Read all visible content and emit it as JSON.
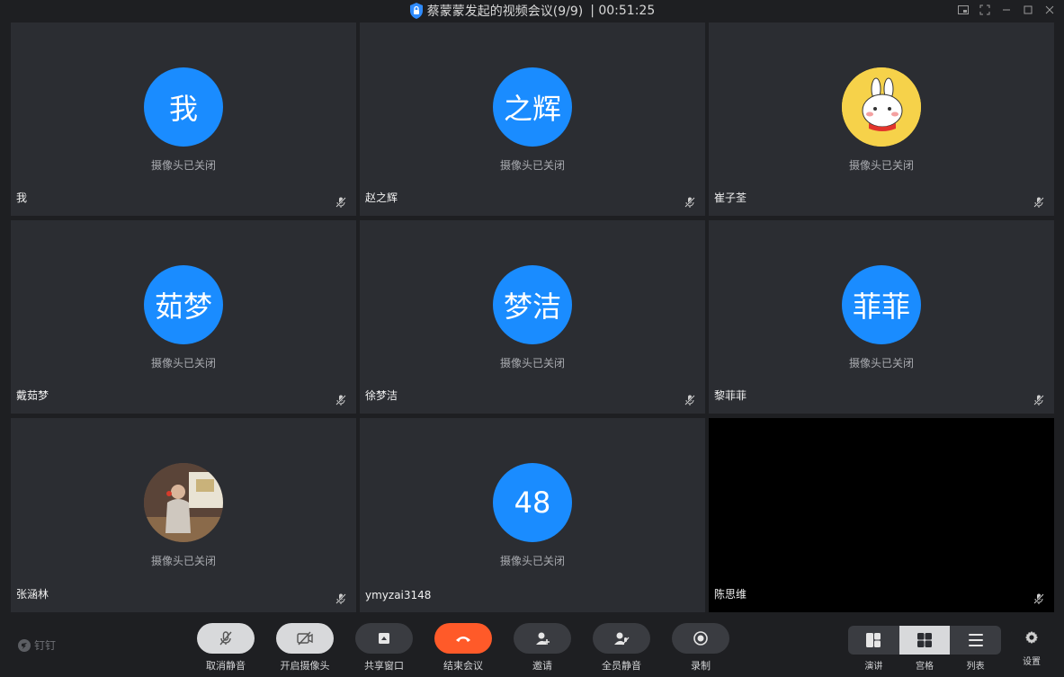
{
  "window": {
    "title": "蔡蒙蒙发起的视频会议(9/9)",
    "timer": "| 00:51:25"
  },
  "tiles": [
    {
      "avatar_text": "我",
      "status": "摄像头已关闭",
      "name": "我"
    },
    {
      "avatar_text": "之辉",
      "status": "摄像头已关闭",
      "name": "赵之辉"
    },
    {
      "avatar_text": "",
      "status": "摄像头已关闭",
      "name": "崔子荃"
    },
    {
      "avatar_text": "茹梦",
      "status": "摄像头已关闭",
      "name": "戴茹梦"
    },
    {
      "avatar_text": "梦洁",
      "status": "摄像头已关闭",
      "name": "徐梦洁"
    },
    {
      "avatar_text": "菲菲",
      "status": "摄像头已关闭",
      "name": "黎菲菲"
    },
    {
      "avatar_text": "",
      "status": "摄像头已关闭",
      "name": "张涵林"
    },
    {
      "avatar_text": "48",
      "status": "摄像头已关闭",
      "name": "ymyzai3148"
    },
    {
      "avatar_text": "",
      "status": "",
      "name": "陈思维"
    }
  ],
  "toolbar": {
    "brand": "钉钉",
    "unmute": "取消静音",
    "camera_on": "开启摄像头",
    "share_window": "共享窗口",
    "end_meeting": "结束会议",
    "invite": "邀请",
    "mute_all": "全员静音",
    "record": "录制",
    "layout_speaker": "演讲",
    "layout_grid": "宫格",
    "layout_list": "列表",
    "settings": "设置"
  },
  "colors": {
    "avatar_blue": "#1a8cff",
    "end_red": "#ff5a29",
    "tile_bg": "#2b2d32"
  }
}
